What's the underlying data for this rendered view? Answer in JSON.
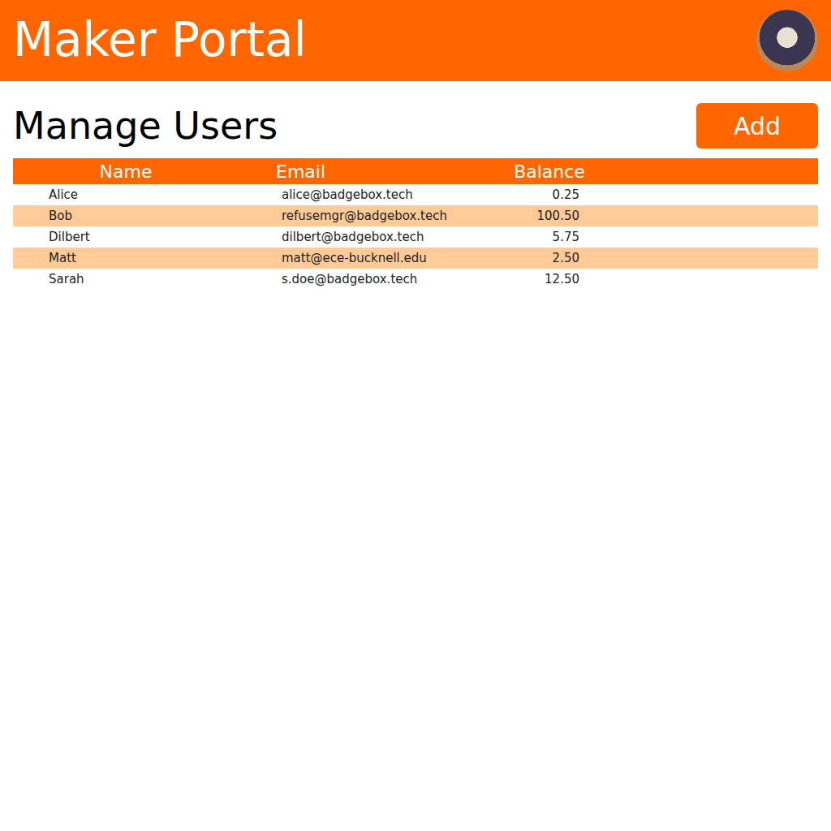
{
  "header": {
    "title": "Maker Portal"
  },
  "page": {
    "heading": "Manage Users",
    "add_button": "Add"
  },
  "table": {
    "columns": [
      "Name",
      "Email",
      "Balance"
    ],
    "rows": [
      {
        "name": "Alice",
        "email": "alice@badgebox.tech",
        "balance": "0.25"
      },
      {
        "name": "Bob",
        "email": "refusemgr@badgebox.tech",
        "balance": "100.50"
      },
      {
        "name": "Dilbert",
        "email": "dilbert@badgebox.tech",
        "balance": "5.75"
      },
      {
        "name": "Matt",
        "email": "matt@ece-bucknell.edu",
        "balance": "2.50"
      },
      {
        "name": "Sarah",
        "email": "s.doe@badgebox.tech",
        "balance": "12.50"
      }
    ]
  }
}
